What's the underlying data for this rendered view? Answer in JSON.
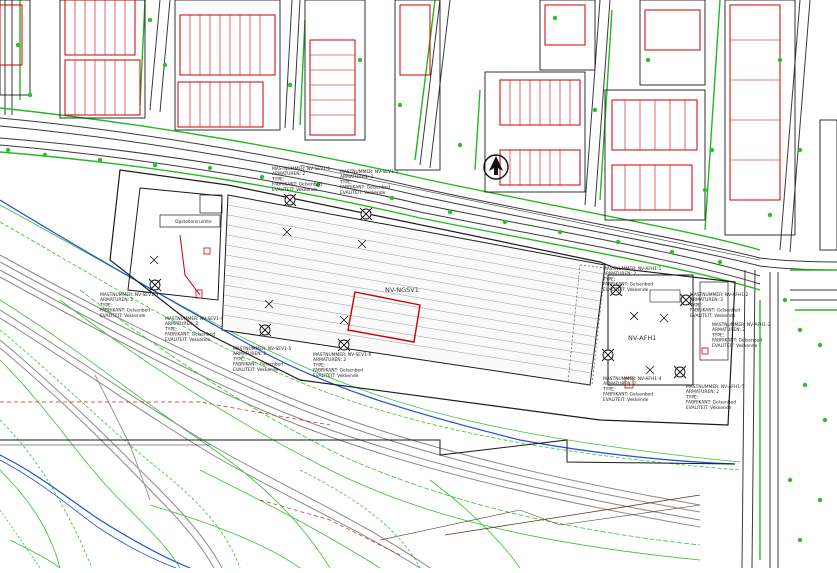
{
  "colors": {
    "road": "#3a3a3a",
    "building": "#1a1a1a",
    "lot_outline": "#cc0000",
    "hedge": "#22b822",
    "contour": "#34c234",
    "rail": "#7a7a7a",
    "water": "#1f4fd4",
    "pole": "#111111"
  },
  "areas": {
    "main": "NV-NGSV1",
    "east": "NV-AFH1"
  },
  "room_label": "Opstellersruimte",
  "north_arrow_icon": "north-arrow-icon",
  "pole_groups": [
    {
      "id": "NV-SEV1-1",
      "lines": [
        "MASTNUMMER: NV-SEV1-1",
        "ARMATUREN: 2",
        "TYPE:",
        "FABRIKANT: Gelsenbed",
        "EVALITEIT: Vekkende"
      ]
    },
    {
      "id": "NV-SEV1-2",
      "lines": [
        "MASTNUMMER: NV-SEV1-2",
        "ARMATUREN: 2",
        "TYPE:",
        "FABRIKANT: Gelsenbed",
        "EVALITEIT: Vekkende"
      ]
    },
    {
      "id": "NV-SEV1-3",
      "lines": [
        "MASTNUMMER: NV-SEV1-3",
        "ARMATUREN: 2",
        "TYPE:",
        "FABRIKANT: Gelsenbed",
        "EVALITEIT: Vekkende"
      ]
    },
    {
      "id": "NV-SEV1-4",
      "lines": [
        "MASTNUMMER: NV-SEV1-4",
        "ARMATUREN: 2",
        "TYPE:",
        "FABRIKANT: Gelsenbed",
        "EVALITEIT: Vekkende"
      ]
    },
    {
      "id": "NV-SEV1-5",
      "lines": [
        "MASTNUMMER: NV-SEV1-5",
        "ARMATUREN: 2",
        "TYPE:",
        "FABRIKANT: Gelsenbed",
        "EVALITEIT: Vekkende"
      ]
    },
    {
      "id": "NV-SEV1-6",
      "lines": [
        "MASTNUMMER: NV-SEV1-6",
        "ARMATUREN: 2",
        "TYPE:",
        "FABRIKANT: Gelsenbed",
        "EVALITEIT: Vekkende"
      ]
    },
    {
      "id": "NV-AFH1-1",
      "lines": [
        "MASTNUMMER: NV-AFH1-1",
        "ARMATUREN: 2",
        "TYPE:",
        "FABRIKANT: Gelsenbed",
        "EVALITEIT: Vekkende"
      ]
    },
    {
      "id": "NV-AFH1-2",
      "lines": [
        "MASTNUMMER: NV-AFH1-2",
        "ARMATUREN: 2",
        "TYPE:",
        "FABRIKANT: Gelsenbed",
        "EVALITEIT: Vekkende"
      ]
    },
    {
      "id": "NV-AFH1-3",
      "lines": [
        "MASTNUMMER: NV-AFH1-3",
        "ARMATUREN: 2",
        "TYPE:",
        "FABRIKANT: Gelsenbed",
        "EVALITEIT: Vekkende"
      ]
    },
    {
      "id": "NV-AFH1-4",
      "lines": [
        "MASTNUMMER: NV-AFH1-4",
        "ARMATUREN: 2",
        "TYPE:",
        "FABRIKANT: Gelsenbed",
        "EVALITEIT: Vekkende"
      ]
    },
    {
      "id": "NV-AFH1-5",
      "lines": [
        "MASTNUMMER: NV-AFH1-5",
        "ARMATUREN: 2",
        "TYPE:",
        "FABRIKANT: Gelsenbed",
        "EVALITEIT: Vekkende"
      ]
    }
  ]
}
